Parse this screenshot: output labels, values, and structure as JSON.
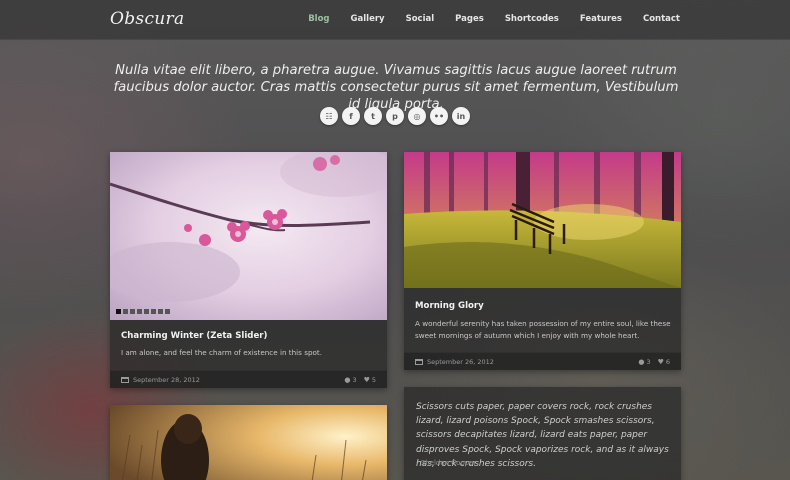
{
  "header": {
    "logo": "Obscura",
    "nav": [
      "Blog",
      "Gallery",
      "Social",
      "Pages",
      "Shortcodes",
      "Features",
      "Contact"
    ],
    "active_nav": "Blog"
  },
  "intro": {
    "text": "Nulla vitae elit libero, a pharetra augue. Vivamus sagittis lacus augue laoreet rutrum faucibus dolor auctor. Cras mattis consectetur purus sit amet fermentum, Vestibulum id ligula porta."
  },
  "social": [
    {
      "name": "rss-icon",
      "glyph": "☷"
    },
    {
      "name": "facebook-icon",
      "glyph": "f"
    },
    {
      "name": "twitter-icon",
      "glyph": "t"
    },
    {
      "name": "pinterest-icon",
      "glyph": "p"
    },
    {
      "name": "dribbble-icon",
      "glyph": "◎"
    },
    {
      "name": "flickr-icon",
      "glyph": "••"
    },
    {
      "name": "linkedin-icon",
      "glyph": "in"
    }
  ],
  "posts": {
    "post1": {
      "title": "Charming Winter (Zeta Slider)",
      "excerpt": "I am alone, and feel the charm of existence in this spot.",
      "date": "September 28, 2012",
      "comments": "3",
      "likes": "5",
      "slides": 8
    },
    "post2": {
      "title": "Morning Glory",
      "excerpt": "A wonderful serenity has taken possession of my entire soul, like these sweet mornings of autumn which I enjoy with my whole heart.",
      "date": "September 26, 2012",
      "comments": "3",
      "likes": "6"
    },
    "quote": {
      "text": "Scissors cuts paper, paper covers rock, rock crushes lizard, lizard poisons Spock, Spock smashes scissors, scissors decapitates lizard, lizard eats paper, paper disproves Spock, Spock vaporizes rock, and as it always has, rock crushes scissors.",
      "author": "- Sheldon Cooper"
    }
  },
  "colors": {
    "accent": "#9cc0a0",
    "card_bg": "#2a2a2a",
    "blossom": "#d8589a"
  }
}
